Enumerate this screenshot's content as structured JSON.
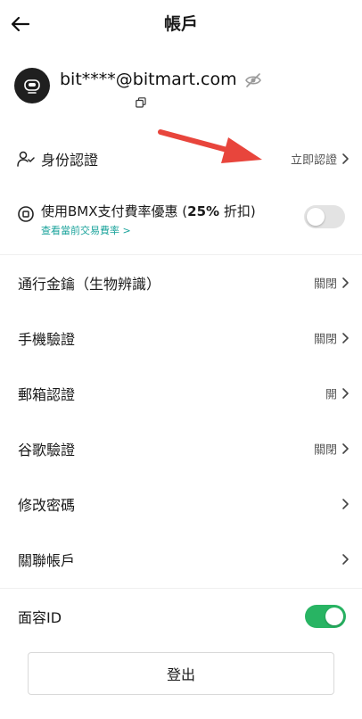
{
  "header": {
    "title": "帳戶"
  },
  "profile": {
    "email": "bit****@bitmart.com"
  },
  "kyc": {
    "label": "身份認證",
    "value": "立即認證"
  },
  "bmx": {
    "label_main": "使用BMX支付費率優惠 (",
    "label_bold": "25%",
    "label_tail": " 折扣)",
    "link": "查看當前交易費率 >",
    "enabled": false
  },
  "settings": [
    {
      "label": "通行金鑰（生物辨識）",
      "value": "關閉"
    },
    {
      "label": "手機驗證",
      "value": "關閉"
    },
    {
      "label": "郵箱認證",
      "value": "開"
    },
    {
      "label": "谷歌驗證",
      "value": "關閉"
    },
    {
      "label": "修改密碼",
      "value": ""
    },
    {
      "label": "關聯帳戶",
      "value": ""
    }
  ],
  "face_id": {
    "label": "面容ID",
    "enabled": true
  },
  "logout": {
    "label": "登出"
  },
  "colors": {
    "accent_green": "#28b463",
    "link_teal": "#1aa39b",
    "annotation_red": "#e8453c"
  },
  "icons": {
    "back": "arrow-left-icon",
    "eye": "eye-off-icon",
    "copy": "copy-icon",
    "kyc": "user-check-icon",
    "bmx": "coin-icon",
    "chevron": "chevron-right-icon"
  }
}
